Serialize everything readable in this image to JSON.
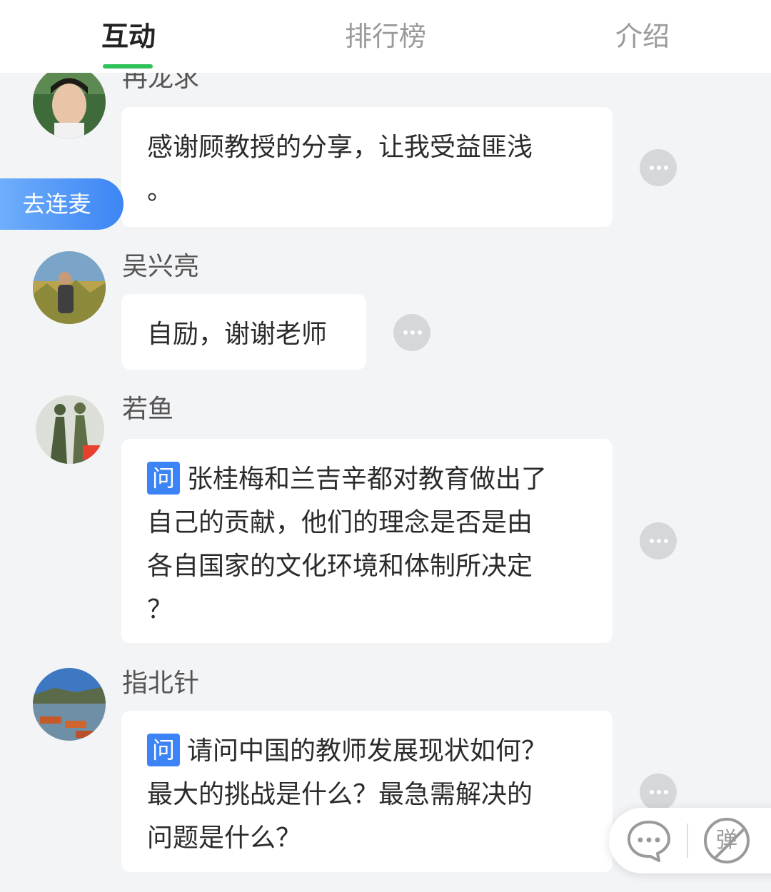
{
  "tabs": [
    {
      "label": "互动",
      "active": true
    },
    {
      "label": "排行榜",
      "active": false
    },
    {
      "label": "介绍",
      "active": false
    }
  ],
  "lianmai_button": "去连麦",
  "question_tag": "问",
  "messages": [
    {
      "name": "冉龙求",
      "lines": [
        "感谢顾教授的分享，让我受益匪浅",
        "。"
      ],
      "is_question": false
    },
    {
      "name": "吴兴亮",
      "lines": [
        "自励，谢谢老师"
      ],
      "is_question": false
    },
    {
      "name": "若鱼",
      "lines": [
        "张桂梅和兰吉辛都对教育做出了",
        "自己的贡献，他们的理念是否是由",
        "各自国家的文化环境和体制所决定",
        "？"
      ],
      "is_question": true
    },
    {
      "name": "指北针",
      "lines": [
        "请问中国的教师发展现状如何？",
        "最大的挑战是什么？最急需解决的",
        "问题是什么？"
      ],
      "is_question": true
    }
  ],
  "actions": {
    "chat_icon": "chat-bubble-icon",
    "danmu_label": "弹"
  },
  "colors": {
    "tab_underline": "#2fc25b",
    "question_tag": "#3c84f6",
    "lianmai": "#3c85f4"
  }
}
